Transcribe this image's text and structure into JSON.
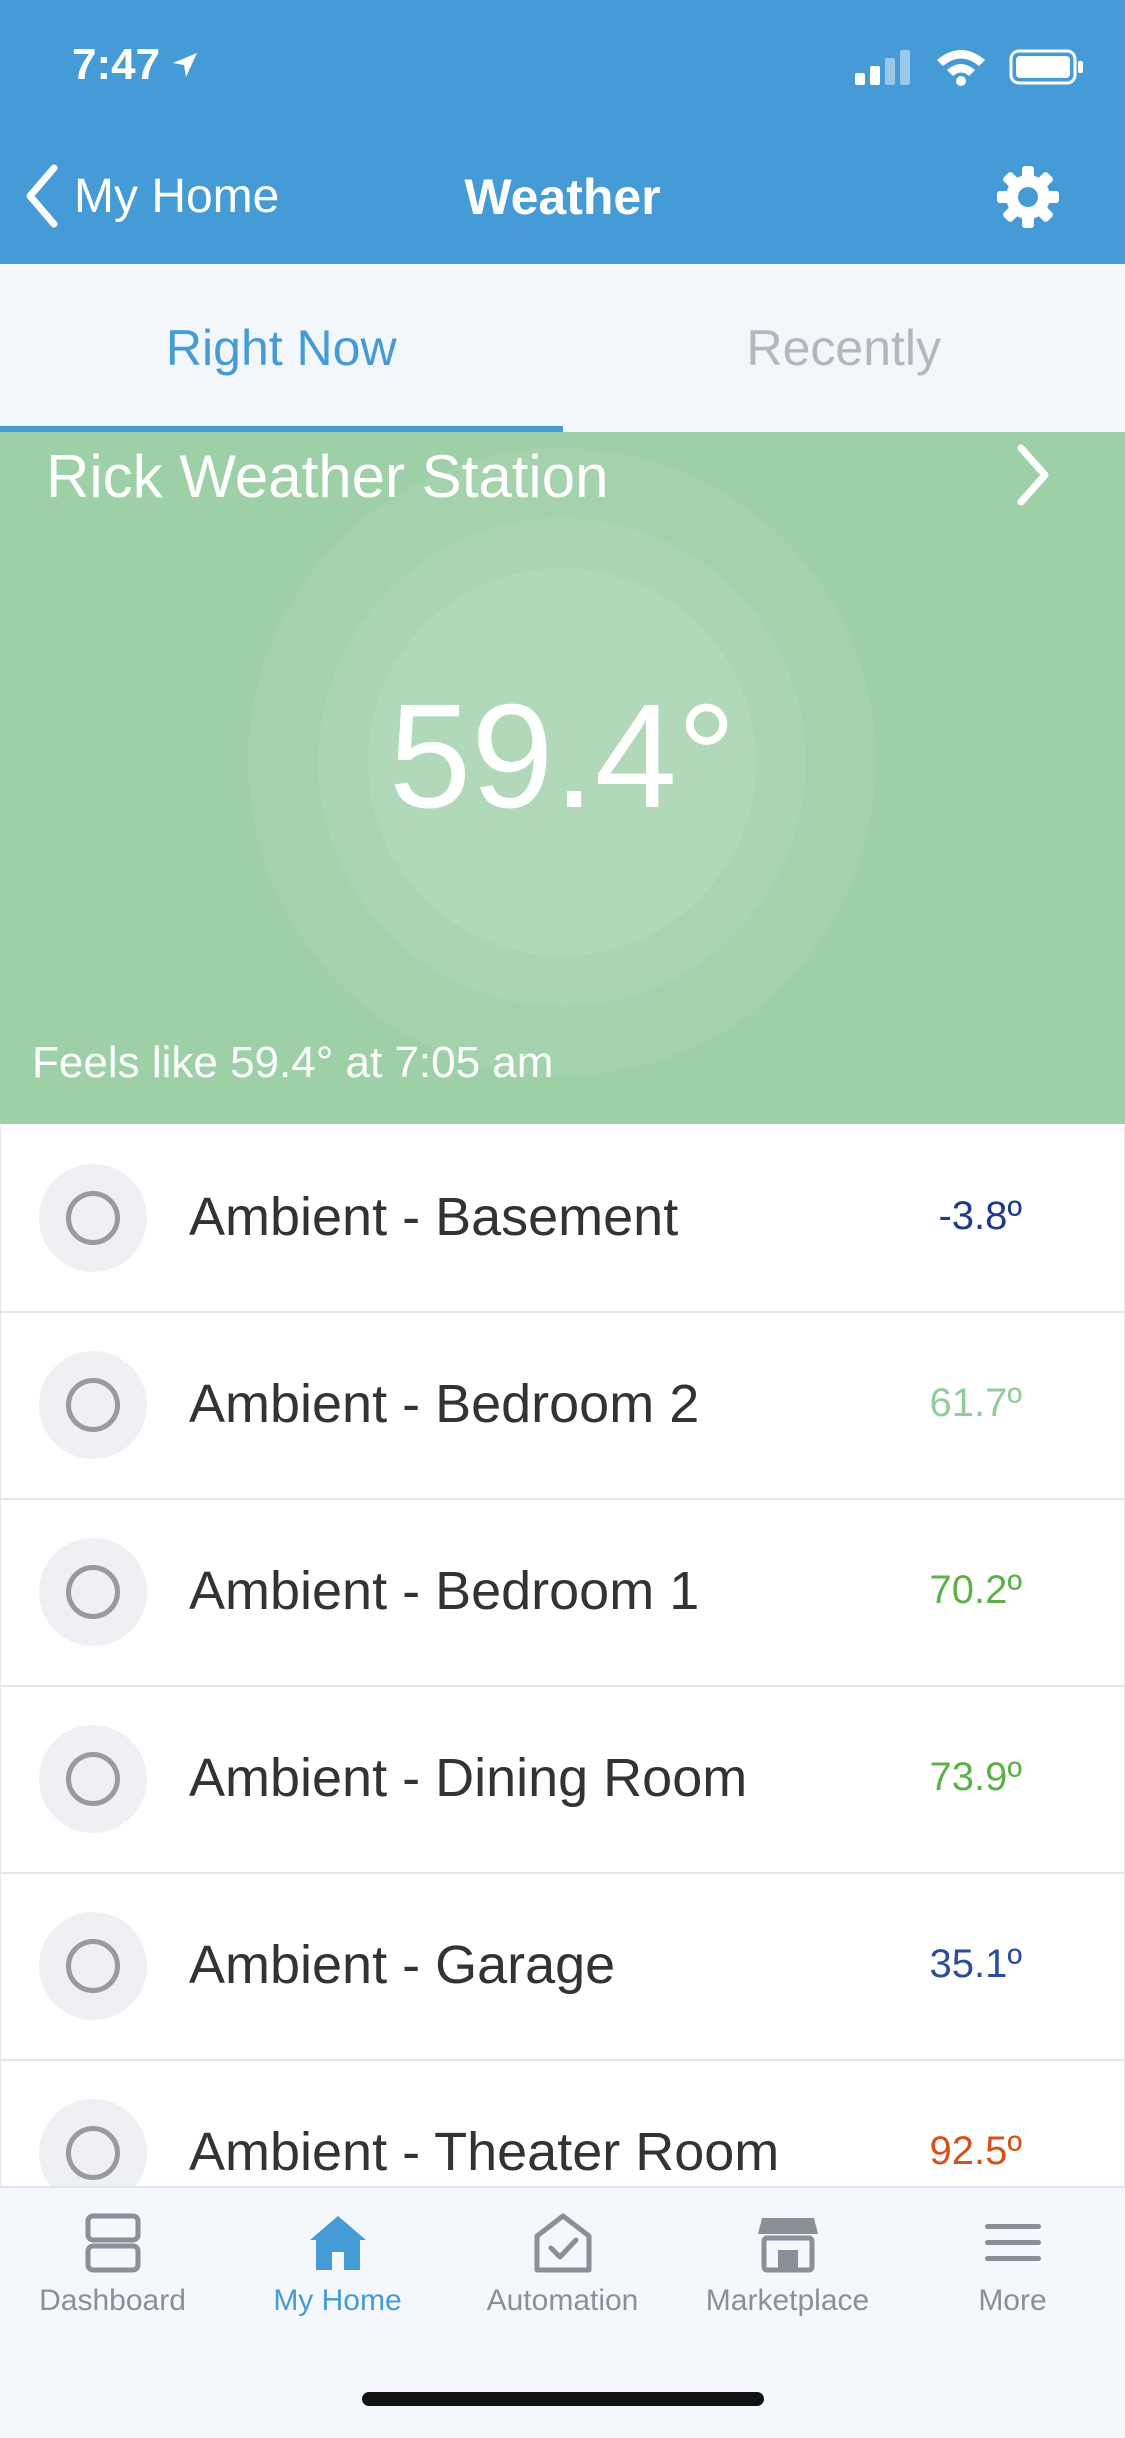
{
  "status_bar": {
    "time": "7:47"
  },
  "nav": {
    "back_label": "My Home",
    "title": "Weather"
  },
  "tabs": [
    {
      "label": "Right Now",
      "active": true
    },
    {
      "label": "Recently",
      "active": false
    }
  ],
  "station": {
    "name": "Rick Weather Station",
    "temperature": "59.4°",
    "feels_like": "Feels like 59.4° at 7:05 am"
  },
  "sensors": [
    {
      "name": "Ambient - Basement",
      "value": "-3.8º",
      "color": "#1e3a8a"
    },
    {
      "name": "Ambient - Bedroom 2",
      "value": "61.7º",
      "color": "#92cc9a"
    },
    {
      "name": "Ambient - Bedroom 1",
      "value": "70.2º",
      "color": "#5fb048"
    },
    {
      "name": "Ambient - Dining Room",
      "value": "73.9º",
      "color": "#5fb048"
    },
    {
      "name": "Ambient - Garage",
      "value": "35.1º",
      "color": "#2b4d9b"
    },
    {
      "name": "Ambient - Theater Room",
      "value": "92.5º",
      "color": "#d4531c"
    }
  ],
  "bottom_nav": [
    {
      "label": "Dashboard",
      "icon": "dashboard-icon",
      "active": false
    },
    {
      "label": "My Home",
      "icon": "home-icon",
      "active": true
    },
    {
      "label": "Automation",
      "icon": "automation-icon",
      "active": false
    },
    {
      "label": "Marketplace",
      "icon": "marketplace-icon",
      "active": false
    },
    {
      "label": "More",
      "icon": "menu-icon",
      "active": false
    }
  ],
  "colors": {
    "accent": "#459bd6",
    "hero": "#9ed0a8"
  }
}
